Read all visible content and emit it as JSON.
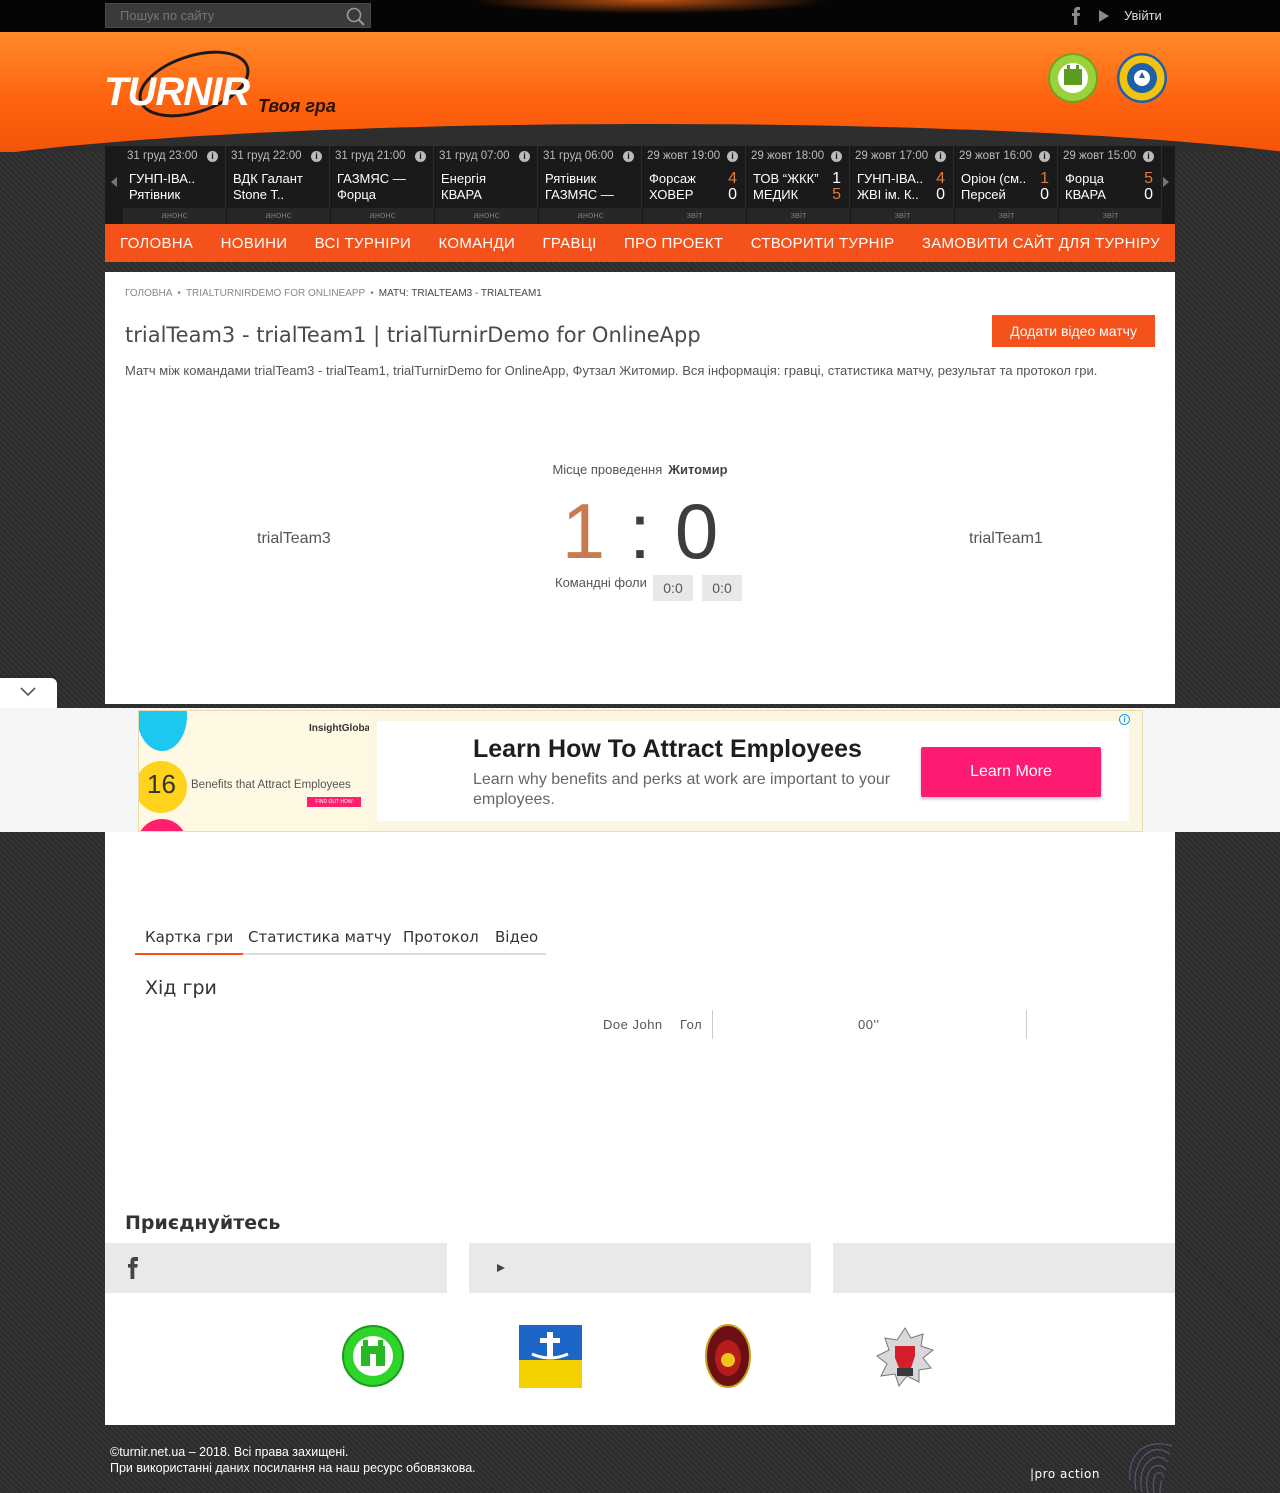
{
  "topbar": {
    "search_placeholder": "Пошук по сайту",
    "login_label": "Увійти"
  },
  "header": {
    "logo_text": "TURNIR",
    "tagline": "Твоя гра"
  },
  "matches": [
    {
      "date": "31 груд 23:00",
      "team1": "ГУНП-ІВА..",
      "team2": "Рятівник",
      "score1": "",
      "score2": "",
      "status": "анонс"
    },
    {
      "date": "31 груд 22:00",
      "team1": "ВДК Галант",
      "team2": "Stone T..",
      "score1": "",
      "score2": "",
      "status": "анонс"
    },
    {
      "date": "31 груд 21:00",
      "team1": "ГАЗМЯС —",
      "team2": "Форца",
      "score1": "",
      "score2": "",
      "status": "анонс"
    },
    {
      "date": "31 груд 07:00",
      "team1": "Енергія",
      "team2": "КВАРА",
      "score1": "",
      "score2": "",
      "status": "анонс"
    },
    {
      "date": "31 груд 06:00",
      "team1": "Рятівник",
      "team2": "ГАЗМЯС —",
      "score1": "",
      "score2": "",
      "status": "анонс"
    },
    {
      "date": "29 жовт 19:00",
      "team1": "Форсаж",
      "team2": "ХОВЕР",
      "score1": "4",
      "score2": "0",
      "status": "звіт",
      "win": 1
    },
    {
      "date": "29 жовт 18:00",
      "team1": "ТОВ “ЖКК”",
      "team2": "МЕДИК",
      "score1": "1",
      "score2": "5",
      "status": "звіт",
      "win": 2
    },
    {
      "date": "29 жовт 17:00",
      "team1": "ГУНП-ІВА..",
      "team2": "ЖВІ ім. К..",
      "score1": "4",
      "score2": "0",
      "status": "звіт",
      "win": 1
    },
    {
      "date": "29 жовт 16:00",
      "team1": "Оріон (см..",
      "team2": "Персей",
      "score1": "1",
      "score2": "0",
      "status": "звіт",
      "win": 1
    },
    {
      "date": "29 жовт 15:00",
      "team1": "Форца",
      "team2": "КВАРА",
      "score1": "5",
      "score2": "0",
      "status": "звіт",
      "win": 1
    }
  ],
  "nav": [
    "ГОЛОВНА",
    "НОВИНИ",
    "ВСІ ТУРНІРИ",
    "КОМАНДИ",
    "ГРАВЦІ",
    "ПРО ПРОЕКТ",
    "СТВОРИТИ ТУРНІР",
    "ЗАМОВИТИ САЙТ ДЛЯ ТУРНІРУ"
  ],
  "breadcrumb": {
    "home": "ГОЛОВНА",
    "tournament": "TRIALTURNIRDEMO FOR ONLINEAPP",
    "current": "МАТЧ: TRIALTEAM3 - TRIALTEAM1"
  },
  "page": {
    "title": "trialTeam3 - trialTeam1 | trialTurnirDemo for OnlineApp",
    "add_video_label": "Додати відео матчу",
    "description": "Матч між командами trialTeam3 - trialTeam1, trialTurnirDemo for OnlineApp, Футзал Житомир. Вся інформація: гравці, статистика матчу, результат та протокол гри."
  },
  "match": {
    "venue_label": "Місце проведення",
    "venue": "Житомир",
    "home_team": "trialTeam3",
    "away_team": "trialTeam1",
    "home_score": "1",
    "colon": ":",
    "away_score": "0",
    "fouls_label": "Командні фоли",
    "home_fouls": "0:0",
    "away_fouls": "0:0"
  },
  "ad": {
    "brand": "InsightGlobal",
    "number": "16",
    "image_caption": "Benefits that Attract Employees",
    "image_button": "FIND OUT HOW",
    "title": "Learn How To Attract Employees",
    "subtitle": "Learn why benefits and perks at work are important to your employees.",
    "cta": "Learn More"
  },
  "tabs": [
    "Картка гри",
    "Статистика матчу",
    "Протокол",
    "Відео"
  ],
  "game": {
    "heading": "Хід гри",
    "event_player": "Doe John",
    "event_type": "Гол",
    "event_time": "00''"
  },
  "join": {
    "heading": "Приєднуйтесь"
  },
  "footer": {
    "line1": "©turnir.net.ua – 2018. Всі права захищені.",
    "line2": "При використанні даних посилання на наш ресурс обовязкова.",
    "studio": "|pro action"
  },
  "colors": {
    "accent": "#f5511b",
    "home_score": "#c87b4f",
    "ad_cta": "#ff1a73"
  }
}
